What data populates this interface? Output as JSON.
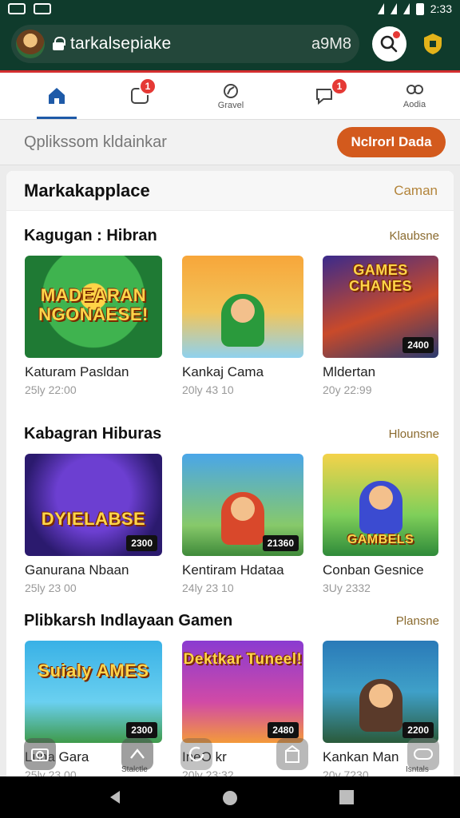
{
  "status_bar": {
    "time": "2:33"
  },
  "browser": {
    "url": "tarkalsepiake",
    "url_right": "a9M8"
  },
  "nav": [
    {
      "label": "",
      "badge": ""
    },
    {
      "label": "",
      "badge": "1"
    },
    {
      "label": "Gravel",
      "badge": ""
    },
    {
      "label": "",
      "badge": "1"
    },
    {
      "label": "Aodia",
      "badge": ""
    }
  ],
  "search": {
    "placeholder": "Qplikssom kldainkar",
    "button": "Nclrorl Dada"
  },
  "marketplace": {
    "title": "Markakapplace",
    "link": "Caman"
  },
  "sections": [
    {
      "title": "Kagugan : Hibran",
      "link": "Klaubsne",
      "cards": [
        {
          "title": "Katuram Pasldan",
          "date": "25ly 22:00",
          "art": "MADEARAN NGONAESE!",
          "tag": ""
        },
        {
          "title": "Kankaj Cama",
          "date": "20ly 43 10",
          "art": "",
          "tag": ""
        },
        {
          "title": "Mldertan",
          "date": "20y 22:99",
          "art": "GAMES CHANES",
          "tag": "2400"
        }
      ]
    },
    {
      "title": "Kabagran Hiburas",
      "link": "Hlounsne",
      "cards": [
        {
          "title": "Ganurana Nbaan",
          "date": "25ly 23 00",
          "art": "DYIELABSE",
          "tag": "2300"
        },
        {
          "title": "Kentiram Hdataa",
          "date": "24ly 23 10",
          "art": "",
          "tag": "21360"
        },
        {
          "title": "Conban Gesnice",
          "date": "3Uy 2332",
          "art": "GAMBELS",
          "tag": ""
        }
      ]
    },
    {
      "title": "Plibkarsh Indlayaan Gamen",
      "link": "Plansne",
      "cards": [
        {
          "title": "Luna Gara",
          "date": "25ly 23 00",
          "art": "Suialy AMES",
          "tag": "2300"
        },
        {
          "title": "IneO kr",
          "date": "20ly 23:32",
          "art": "Dektkar Tuneel!",
          "tag": "2480"
        },
        {
          "title": "Kankan Man",
          "date": "20y 7230",
          "art": "",
          "tag": "2200"
        }
      ]
    }
  ],
  "bottom_labels": {
    "b2": "Stalctle",
    "b5": "Isntals"
  }
}
